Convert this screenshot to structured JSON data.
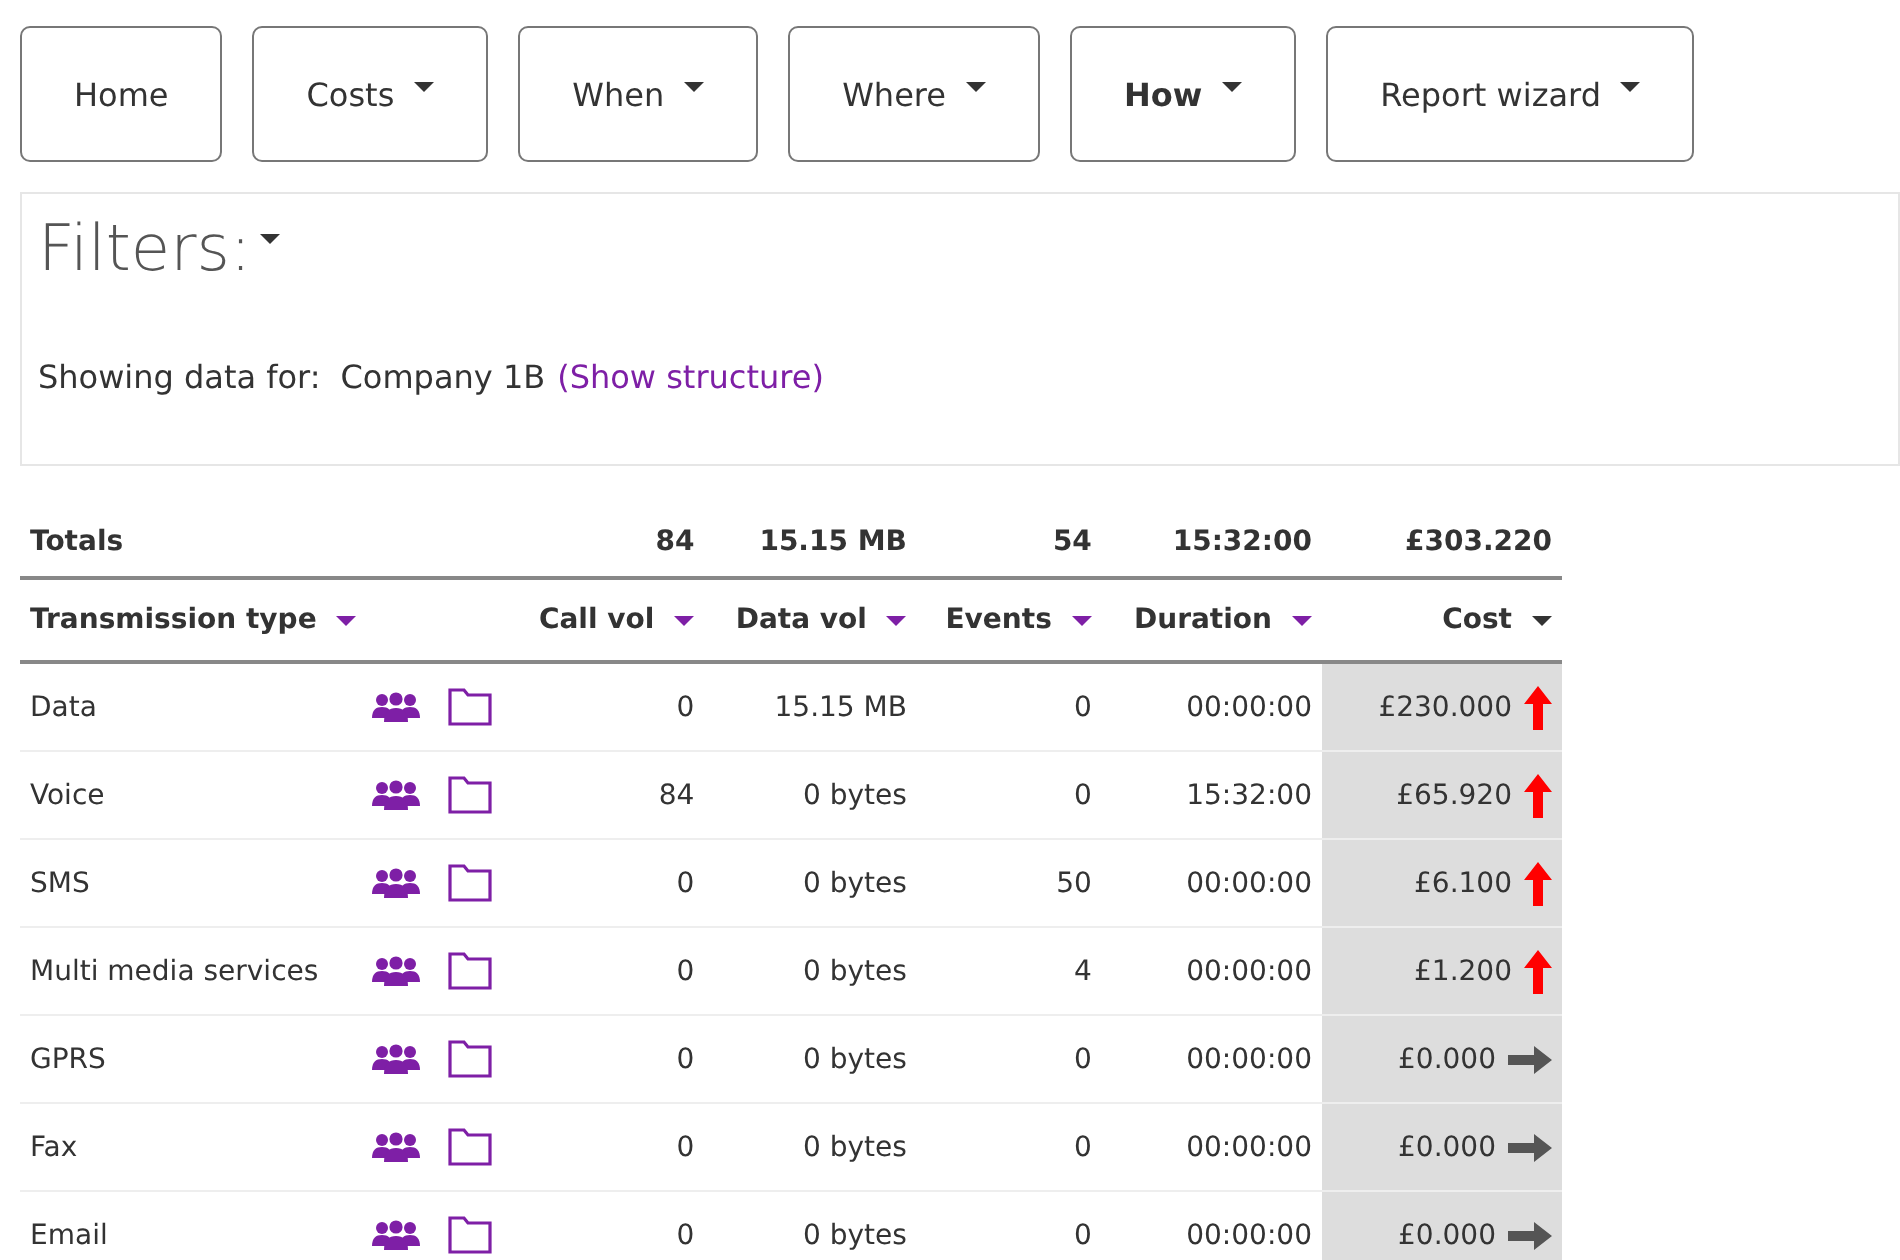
{
  "nav": [
    {
      "label": "Home",
      "dropdown": false,
      "selected": false
    },
    {
      "label": "Costs",
      "dropdown": true,
      "selected": false
    },
    {
      "label": "When",
      "dropdown": true,
      "selected": false
    },
    {
      "label": "Where",
      "dropdown": true,
      "selected": false
    },
    {
      "label": "How",
      "dropdown": true,
      "selected": true
    },
    {
      "label": "Report wizard",
      "dropdown": true,
      "selected": false
    }
  ],
  "filters": {
    "title": "Filters:",
    "showing_label": "Showing data for:",
    "company": "Company 1B",
    "link": "(Show structure)"
  },
  "table": {
    "totals": {
      "label": "Totals",
      "call_vol": "84",
      "data_vol": "15.15 MB",
      "events": "54",
      "duration": "15:32:00",
      "cost": "£303.220"
    },
    "columns": [
      {
        "label": "Transmission type",
        "sorted": false
      },
      {
        "label": "Call vol",
        "sorted": false
      },
      {
        "label": "Data vol",
        "sorted": false
      },
      {
        "label": "Events",
        "sorted": false
      },
      {
        "label": "Duration",
        "sorted": false
      },
      {
        "label": "Cost",
        "sorted": true
      }
    ],
    "rows": [
      {
        "type": "Data",
        "call_vol": "0",
        "data_vol": "15.15 MB",
        "events": "0",
        "duration": "00:00:00",
        "cost": "£230.000",
        "kind": "up"
      },
      {
        "type": "Voice",
        "call_vol": "84",
        "data_vol": "0 bytes",
        "events": "0",
        "duration": "15:32:00",
        "cost": "£65.920",
        "kind": "up"
      },
      {
        "type": "SMS",
        "call_vol": "0",
        "data_vol": "0 bytes",
        "events": "50",
        "duration": "00:00:00",
        "cost": "£6.100",
        "kind": "up"
      },
      {
        "type": "Multi media services",
        "call_vol": "0",
        "data_vol": "0 bytes",
        "events": "4",
        "duration": "00:00:00",
        "cost": "£1.200",
        "kind": "up"
      },
      {
        "type": "GPRS",
        "call_vol": "0",
        "data_vol": "0 bytes",
        "events": "0",
        "duration": "00:00:00",
        "cost": "£0.000",
        "kind": "flat"
      },
      {
        "type": "Fax",
        "call_vol": "0",
        "data_vol": "0 bytes",
        "events": "0",
        "duration": "00:00:00",
        "cost": "£0.000",
        "kind": "flat"
      },
      {
        "type": "Email",
        "call_vol": "0",
        "data_vol": "0 bytes",
        "events": "0",
        "duration": "00:00:00",
        "cost": "£0.000",
        "kind": "flat"
      }
    ]
  }
}
